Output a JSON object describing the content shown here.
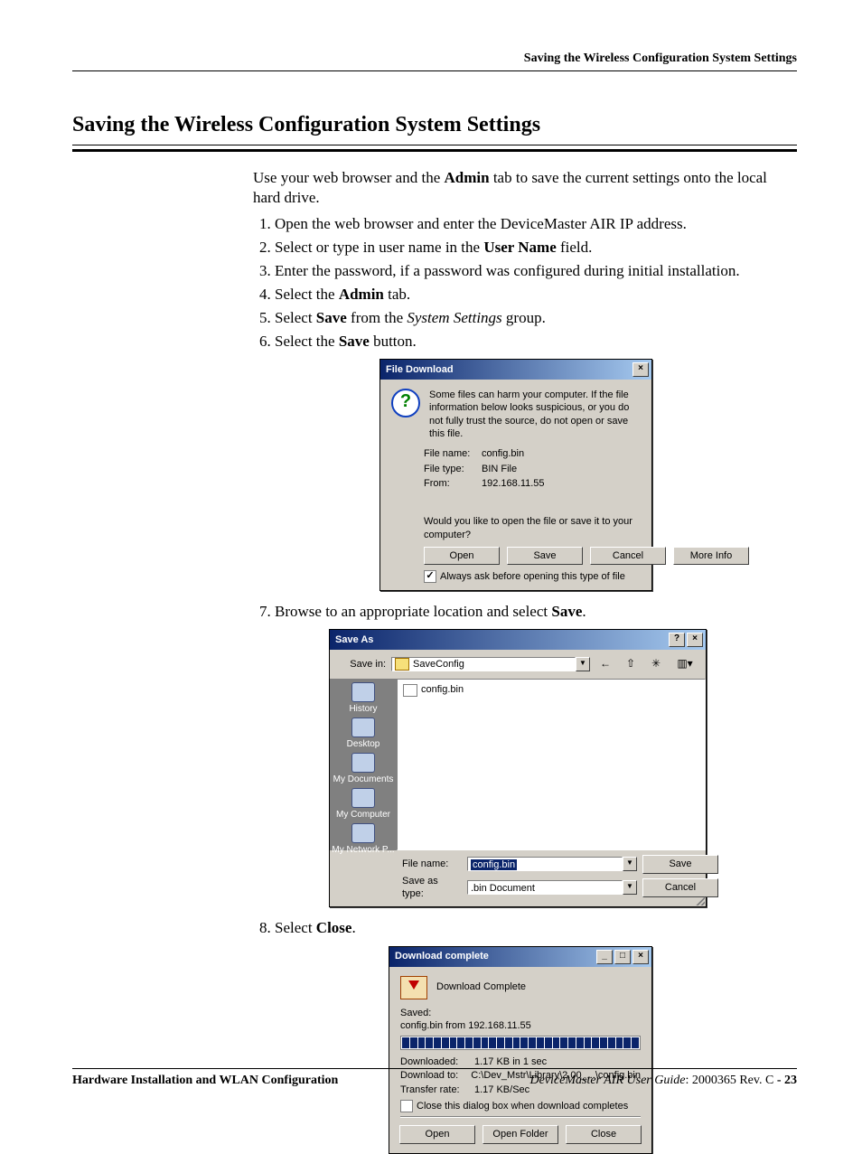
{
  "runningHead": "Saving the Wireless Configuration System Settings",
  "heading": "Saving the Wireless Configuration System Settings",
  "intro": {
    "pre": "Use your web browser and the ",
    "boldA": "Admin",
    "mid": " tab to save the current settings onto the local hard drive."
  },
  "steps": {
    "s1": "Open the web browser and enter the DeviceMaster AIR IP address.",
    "s2": {
      "pre": "Select or type in user name in the ",
      "bold": "User Name",
      "post": " field."
    },
    "s3": "Enter the password, if a password was configured during initial installation.",
    "s4": {
      "pre": "Select the ",
      "bold": "Admin",
      "post": " tab."
    },
    "s5": {
      "pre": "Select ",
      "bold": "Save",
      "mid": " from the ",
      "ital": "System Settings",
      "post": " group."
    },
    "s6": {
      "pre": "Select the ",
      "bold": "Save",
      "post": " button."
    },
    "s7": {
      "pre": "Browse to an appropriate location and select ",
      "bold": "Save",
      "post": "."
    },
    "s8": {
      "pre": "Select ",
      "bold": "Close",
      "post": "."
    }
  },
  "fd": {
    "title": "File Download",
    "closeGlyph": "×",
    "warn": "Some files can harm your computer. If the file information below looks suspicious, or you do not fully trust the source, do not open or save this file.",
    "k_filename": "File name:",
    "v_filename": "config.bin",
    "k_filetype": "File type:",
    "v_filetype": "BIN File",
    "k_from": "From:",
    "v_from": "192.168.11.55",
    "q": "Would you like to open the file or save it to your computer?",
    "btn_open": "Open",
    "btn_save": "Save",
    "btn_cancel": "Cancel",
    "btn_more": "More Info",
    "ask_mark": "✓",
    "ask": "Always ask before opening this type of file"
  },
  "sa": {
    "title": "Save As",
    "helpGlyph": "?",
    "closeGlyph": "×",
    "lbl_savein": "Save in:",
    "loc_value": "SaveConfig",
    "tb_back": "←",
    "tb_up": "⇧",
    "tb_new": "✳",
    "tb_views": "▥",
    "places": {
      "history": "History",
      "desktop": "Desktop",
      "mydocs": "My Documents",
      "mycomp": "My Computer",
      "mynet": "My Network P..."
    },
    "file_in_list": "config.bin",
    "lbl_filename": "File name:",
    "val_filename": "config.bin",
    "lbl_saveas": "Save as type:",
    "val_saveas": ".bin Document",
    "btn_save": "Save",
    "btn_cancel": "Cancel"
  },
  "dc": {
    "title": "Download complete",
    "minGlyph": "_",
    "maxGlyph": "□",
    "closeGlyph": "×",
    "hdr": "Download Complete",
    "savedLabel": "Saved:",
    "savedValue": "config.bin from 192.168.11.55",
    "k_dl": "Downloaded:",
    "v_dl": "1.17 KB in 1 sec",
    "k_to": "Download to:",
    "v_to": "C:\\Dev_Mstr\\Library\\2.00_...\\config.bin",
    "k_rate": "Transfer rate:",
    "v_rate": "1.17 KB/Sec",
    "chk_label": "Close this dialog box when download completes",
    "btn_open": "Open",
    "btn_openf": "Open Folder",
    "btn_close": "Close"
  },
  "footer": {
    "left": "Hardware Installation and WLAN Configuration",
    "rightItalic": "DeviceMaster AIR User Guide",
    "rightRev": ": 2000365 Rev. C ",
    "rightPage": "- 23"
  }
}
